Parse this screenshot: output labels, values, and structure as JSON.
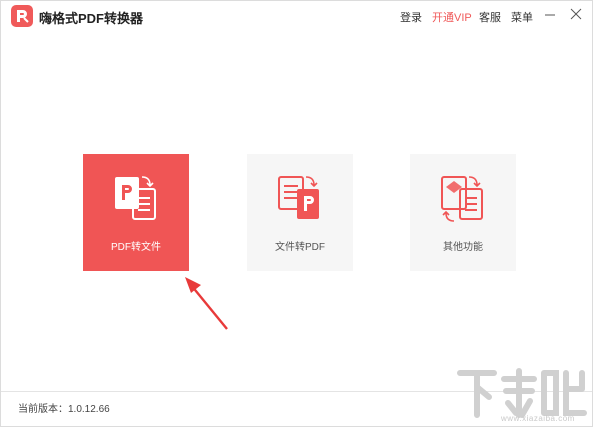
{
  "app": {
    "title": "嗨格式PDF转换器",
    "logo_icon": "pdf-logo-icon",
    "accent_color": "#f05a5a"
  },
  "menu": {
    "login": "登录",
    "vip": "开通VIP",
    "service": "客服",
    "menu": "菜单"
  },
  "window_controls": {
    "minimize_icon": "minimize-icon",
    "close_icon": "close-icon"
  },
  "tiles": [
    {
      "label": "PDF转文件",
      "icon": "pdf-to-file-icon",
      "selected": true
    },
    {
      "label": "文件转PDF",
      "icon": "file-to-pdf-icon",
      "selected": false
    },
    {
      "label": "其他功能",
      "icon": "other-functions-icon",
      "selected": false
    }
  ],
  "footer": {
    "version_text": "当前版本：1.0.12.66"
  },
  "watermark": {
    "text": "下载吧",
    "url": "www.xiazaiba.com"
  }
}
